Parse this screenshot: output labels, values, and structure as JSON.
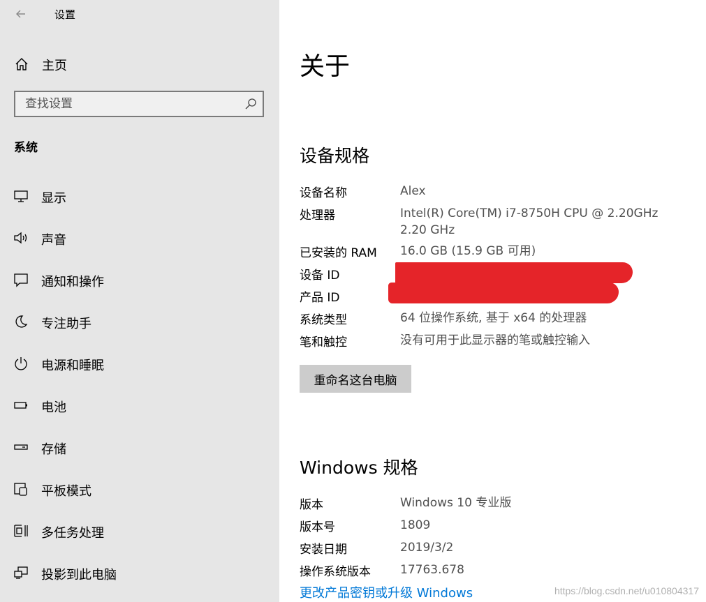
{
  "sidebar": {
    "app_title": "设置",
    "home_label": "主页",
    "search_placeholder": "查找设置",
    "section_title": "系统",
    "items": [
      {
        "label": "显示",
        "icon": "display-icon"
      },
      {
        "label": "声音",
        "icon": "speaker-icon"
      },
      {
        "label": "通知和操作",
        "icon": "notification-icon"
      },
      {
        "label": "专注助手",
        "icon": "moon-icon"
      },
      {
        "label": "电源和睡眠",
        "icon": "power-icon"
      },
      {
        "label": "电池",
        "icon": "battery-icon"
      },
      {
        "label": "存储",
        "icon": "storage-icon"
      },
      {
        "label": "平板模式",
        "icon": "tablet-icon"
      },
      {
        "label": "多任务处理",
        "icon": "multitask-icon"
      },
      {
        "label": "投影到此电脑",
        "icon": "project-icon"
      }
    ]
  },
  "main": {
    "title": "关于",
    "device_specs": {
      "heading": "设备规格",
      "rows": [
        {
          "key": "设备名称",
          "value": "Alex"
        },
        {
          "key": "处理器",
          "value": "Intel(R) Core(TM) i7-8750H CPU @ 2.20GHz   2.20 GHz"
        },
        {
          "key": "已安装的 RAM",
          "value": "16.0 GB (15.9 GB 可用)"
        },
        {
          "key": "设备 ID",
          "value": ""
        },
        {
          "key": "产品 ID",
          "value": ""
        },
        {
          "key": "系统类型",
          "value": "64 位操作系统, 基于 x64 的处理器"
        },
        {
          "key": "笔和触控",
          "value": "没有可用于此显示器的笔或触控输入"
        }
      ],
      "rename_button": "重命名这台电脑"
    },
    "windows_specs": {
      "heading": "Windows 规格",
      "rows": [
        {
          "key": "版本",
          "value": "Windows 10 专业版"
        },
        {
          "key": "版本号",
          "value": "1809"
        },
        {
          "key": "安装日期",
          "value": "2019/3/2"
        },
        {
          "key": "操作系统版本",
          "value": "17763.678"
        }
      ],
      "link": "更改产品密钥或升级 Windows"
    },
    "watermark": "https://blog.csdn.net/u010804317"
  },
  "colors": {
    "sidebar_bg": "#e6e6e6",
    "link": "#0078d7",
    "redaction": "#e52429",
    "button_bg": "#cccccc"
  }
}
